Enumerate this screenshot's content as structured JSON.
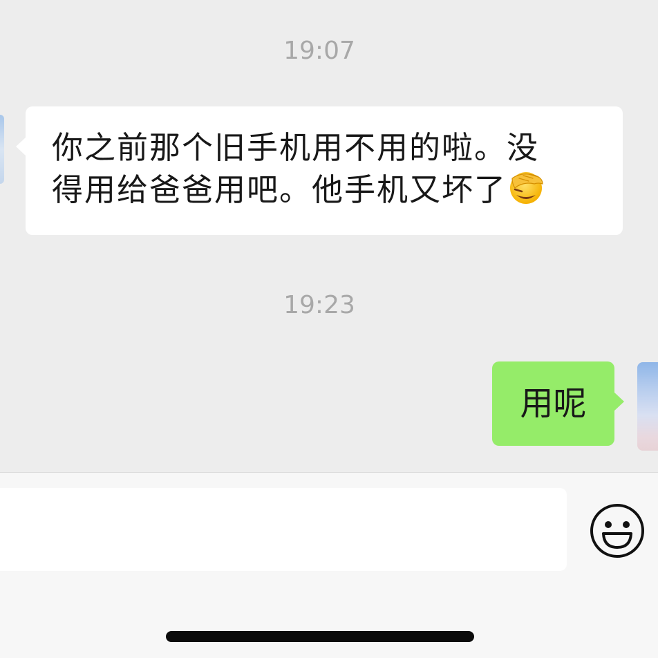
{
  "chat": {
    "timestamps": [
      "19:07",
      "19:23"
    ],
    "messages": [
      {
        "side": "incoming",
        "line1": "你之前那个旧手机用不用的啦。没",
        "line2": "得用给爸爸用吧。他手机又坏了",
        "emoji": "face-palm-emoji"
      },
      {
        "side": "outgoing",
        "text": "用呢"
      }
    ]
  },
  "input_bar": {
    "value": "",
    "emoji_button_icon": "smiley-face-icon"
  },
  "colors": {
    "background": "#ededed",
    "incoming_bubble": "#ffffff",
    "outgoing_bubble": "#95ec69",
    "timestamp": "#a8a8a8",
    "input_bar": "#f7f7f7"
  }
}
